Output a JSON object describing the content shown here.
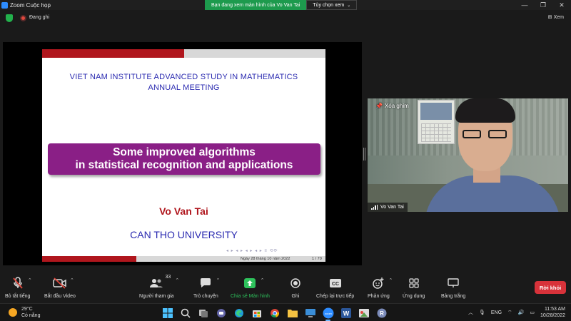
{
  "window": {
    "title": "Zoom Cuộc họp",
    "share_banner": "Bạn đang xem màn hình của Vo Van Tai",
    "view_options": "Tùy chọn xem",
    "recording": "Đang ghi",
    "view_button": "Xem"
  },
  "slide": {
    "institute_line1": "VIET NAM INSTITUTE ADVANCED STUDY IN MATHEMATICS",
    "institute_line2": "ANNUAL MEETING",
    "title_line1": "Some improved algorithms",
    "title_line2": "in statistical recognition and applications",
    "author": "Vo Van Tai",
    "university": "CAN THO UNIVERSITY",
    "footer_date": "Ngày 28 tháng 10 năm 2022",
    "footer_page": "1 / 70",
    "nav_symbols": "◂ ▸ ◂ ▸ ◂ ▸ ◂ ▸  ≡  ⟲⟳"
  },
  "video": {
    "pin_label": "Xóa ghim",
    "participant_name": "Vo Van Tai"
  },
  "toolbar": {
    "mute": "Bỏ tắt tiếng",
    "video": "Bắt đầu Video",
    "participants": "Người tham gia",
    "participants_count": "33",
    "chat": "Trò chuyện",
    "share": "Chia sẻ Màn hình",
    "record": "Ghi",
    "cc": "Chép lại trực tiếp",
    "reactions": "Phản ứng",
    "apps": "Ứng dụng",
    "whiteboard": "Bảng trắng",
    "leave": "Rời khỏi"
  },
  "taskbar": {
    "temperature": "29°C",
    "weather": "Có nắng",
    "language": "ENG",
    "time": "11:53 AM",
    "date": "10/28/2022"
  },
  "colors": {
    "slide_red": "#b0161d",
    "slide_blue": "#2a2ab0",
    "title_purple": "#8a1f86",
    "share_green": "#1d9a4d",
    "leave_red": "#d7323a"
  }
}
